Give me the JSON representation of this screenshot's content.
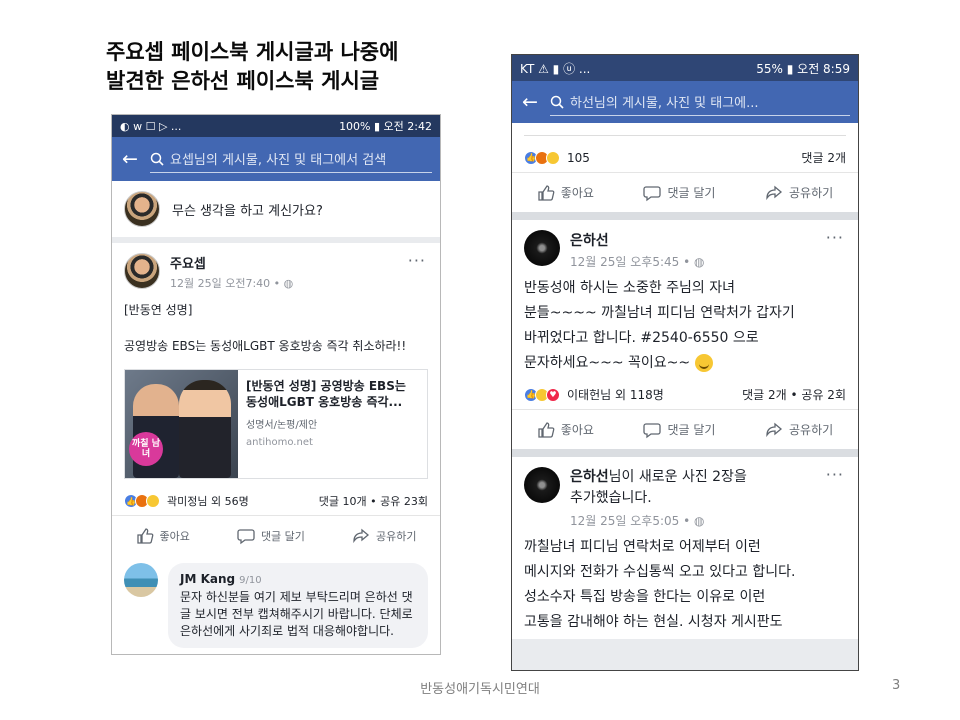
{
  "slide": {
    "title_line1": "주요셉 페이스북 게시글과 나중에",
    "title_line2": "발견한 은하선 페이스북 게시글",
    "footer": "반동성애기독시민연대",
    "page_number": "3"
  },
  "left_phone": {
    "status": {
      "left": "◐ ᴡ ☐ ▷ ...",
      "right": "100% ▮ 오전 2:42"
    },
    "search_placeholder": "요셉님의 게시물, 사진 및 태그에서 검색",
    "composer_prompt": "무슨 생각을 하고 계신가요?",
    "post": {
      "author": "주요셉",
      "time": "12월 25일 오전7:40 • ◍",
      "text": "[반동연 성명]\n\n공영방송 EBS는 동성애LGBT 옹호방송 즉각 취소하라!!",
      "link": {
        "title": "[반동연 성명] 공영방송 EBS는 동성애LGBT 옹호방송 즉각...",
        "subtitle": "성명서/논평/제안",
        "domain": "antihomo.net",
        "thumb_badge": "까칠 남녀"
      },
      "reactions_text": "곽미정님 외 56명",
      "comments_shares": "댓글 10개 • 공유 23회",
      "actions": {
        "like": "좋아요",
        "comment": "댓글 달기",
        "share": "공유하기"
      }
    },
    "comment": {
      "name": "JM Kang",
      "date": "9/10",
      "text": "문자 하신분들 여기 제보 부탁드리며 은하선 댓글 보시면 전부 캡쳐해주시기 바랍니다. 단체로 은하선에게 사기죄로 법적 대응해야합니다."
    }
  },
  "right_phone": {
    "status": {
      "left": "KT ⚠ ▮ ⓤ ...",
      "right": "55% ▮ 오전 8:59"
    },
    "search_placeholder": "하선님의 게시물, 사진 및 태그에...",
    "top_reactions": {
      "count": "105",
      "comments": "댓글 2개"
    },
    "actions": {
      "like": "좋아요",
      "comment": "댓글 달기",
      "share": "공유하기"
    },
    "post1": {
      "author": "은하선",
      "time": "12월 25일 오후5:45 • ◍",
      "text": "반동성애 하시는 소중한 주님의 자녀\n분들~~~~ 까칠남녀 피디님 연락처가 갑자기\n바뀌었다고 합니다. #2540-6550 으로\n문자하세요~~~ 꼭이요~~",
      "reactions_text": "이태헌님 외 118명",
      "comments_shares": "댓글 2개 • 공유 2회"
    },
    "post2": {
      "author": "은하선",
      "author_suffix": "님이 새로운 사진 2장을\n추가했습니다.",
      "time": "12월 25일 오후5:05 • ◍",
      "text": "까칠남녀 피디님 연락처로 어제부터 이런\n메시지와 전화가 수십통씩 오고 있다고 합니다.\n성소수자 특집 방송을 한다는 이유로 이런\n고통을 감내해야 하는 현실. 시청자 게시판도"
    }
  }
}
